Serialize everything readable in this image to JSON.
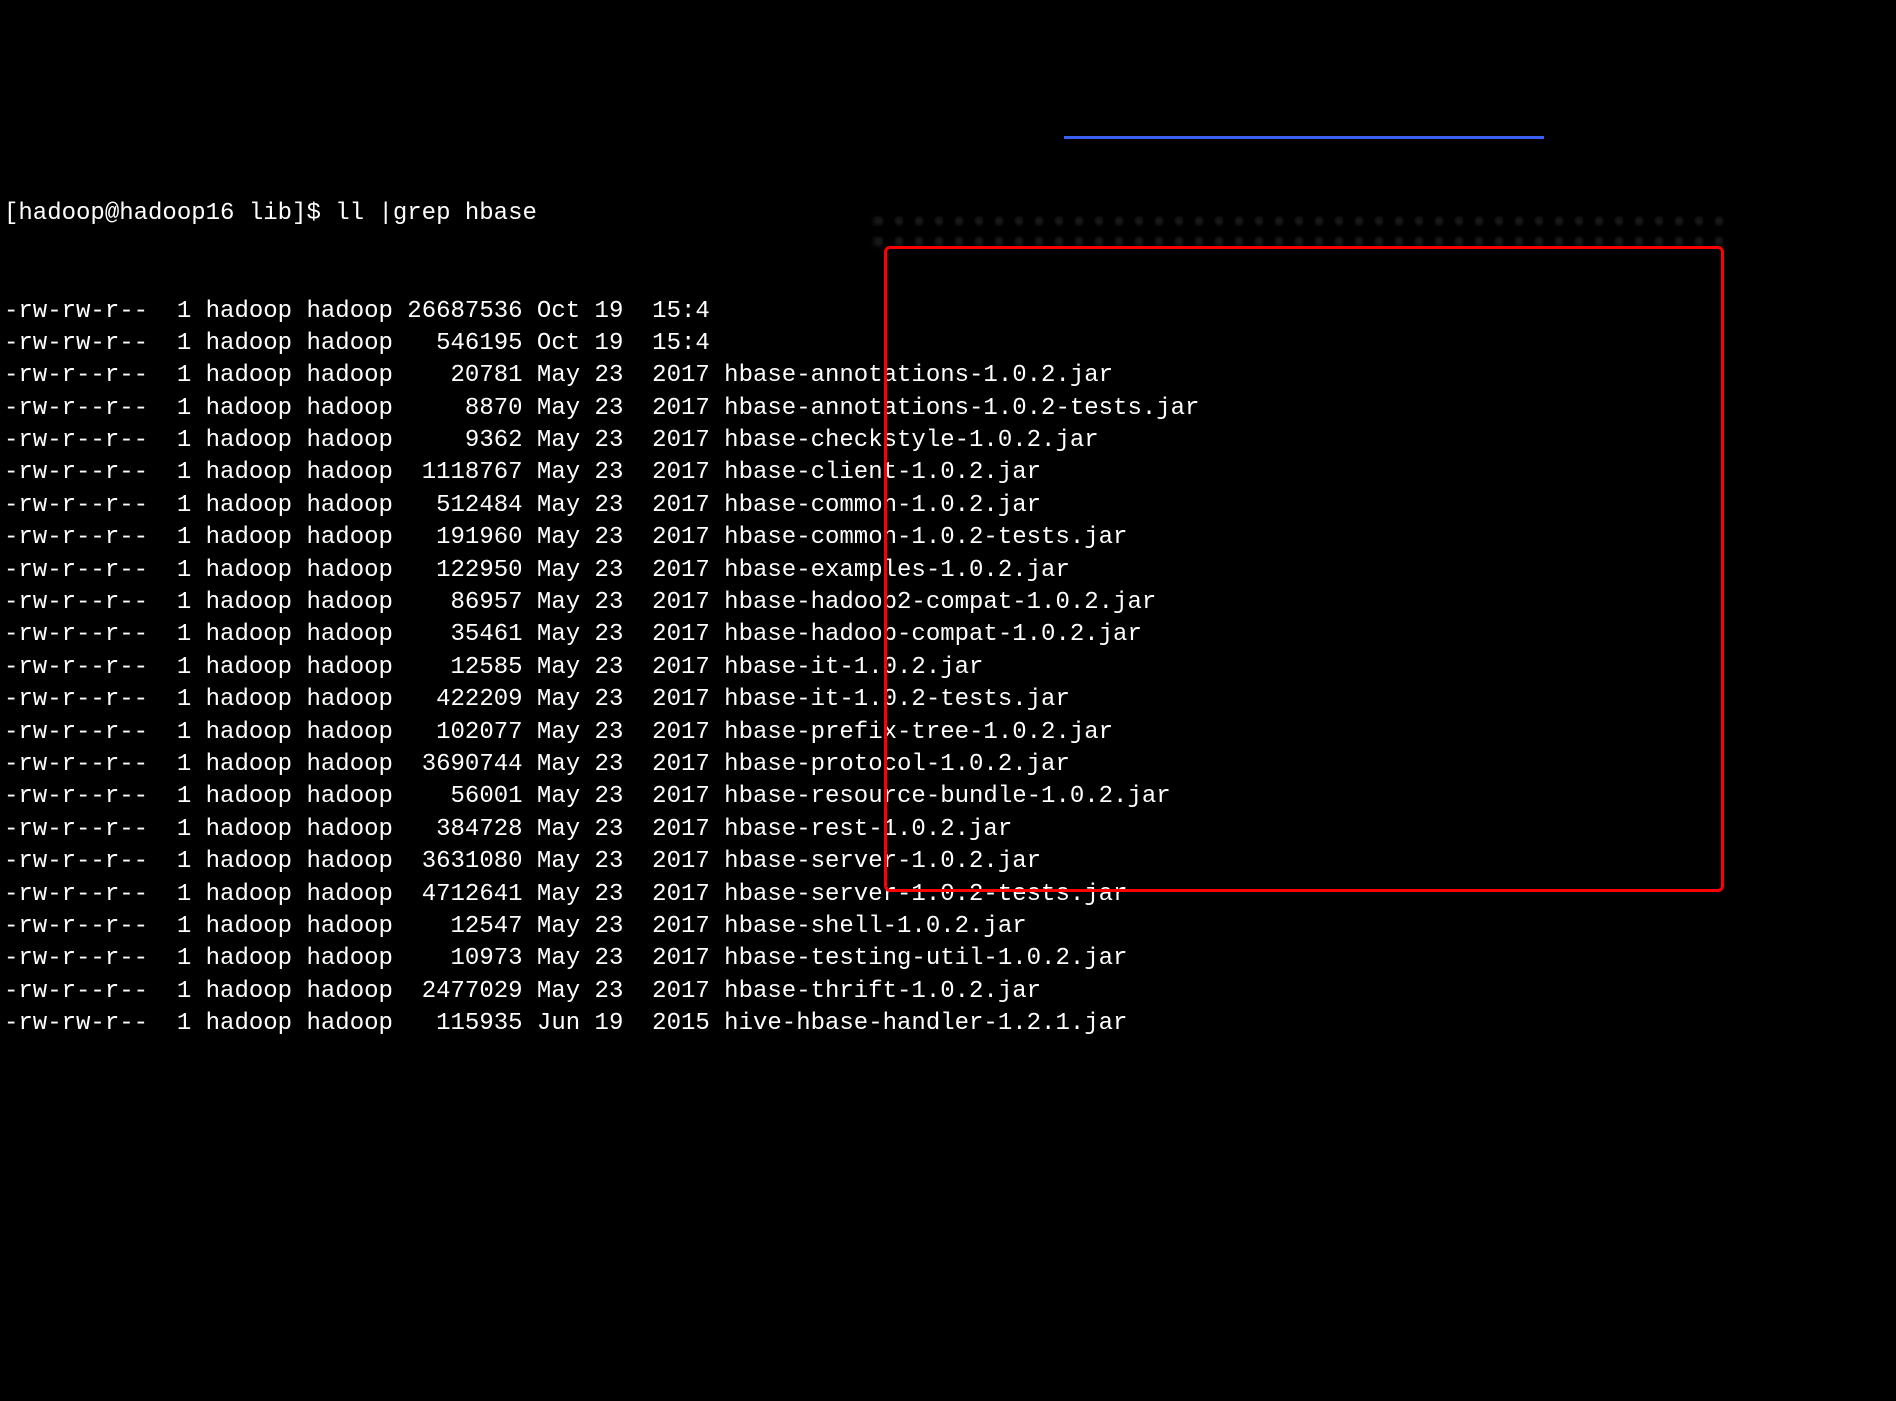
{
  "prompt": "[hadoop@hadoop16 lib]$ ll |grep hbase",
  "rows": [
    {
      "perm": "-rw-rw-r--",
      "links": "1",
      "owner": "hadoop",
      "group": "hadoop",
      "size": "26687536",
      "month": "Oct",
      "day": "19",
      "time": "15:4",
      "filename": "",
      "hl": false
    },
    {
      "perm": "-rw-rw-r--",
      "links": "1",
      "owner": "hadoop",
      "group": "hadoop",
      "size": "546195",
      "month": "Oct",
      "day": "19",
      "time": "15:4",
      "filename": "",
      "hl": false
    },
    {
      "perm": "-rw-r--r--",
      "links": "1",
      "owner": "hadoop",
      "group": "hadoop",
      "size": "20781",
      "month": "May",
      "day": "23",
      "time": "2017",
      "filename": "hbase-annotations-1.0.2.jar",
      "hl": true
    },
    {
      "perm": "-rw-r--r--",
      "links": "1",
      "owner": "hadoop",
      "group": "hadoop",
      "size": "8870",
      "month": "May",
      "day": "23",
      "time": "2017",
      "filename": "hbase-annotations-1.0.2-tests.jar",
      "hl": true
    },
    {
      "perm": "-rw-r--r--",
      "links": "1",
      "owner": "hadoop",
      "group": "hadoop",
      "size": "9362",
      "month": "May",
      "day": "23",
      "time": "2017",
      "filename": "hbase-checkstyle-1.0.2.jar",
      "hl": true
    },
    {
      "perm": "-rw-r--r--",
      "links": "1",
      "owner": "hadoop",
      "group": "hadoop",
      "size": "1118767",
      "month": "May",
      "day": "23",
      "time": "2017",
      "filename": "hbase-client-1.0.2.jar",
      "hl": true
    },
    {
      "perm": "-rw-r--r--",
      "links": "1",
      "owner": "hadoop",
      "group": "hadoop",
      "size": "512484",
      "month": "May",
      "day": "23",
      "time": "2017",
      "filename": "hbase-common-1.0.2.jar",
      "hl": true
    },
    {
      "perm": "-rw-r--r--",
      "links": "1",
      "owner": "hadoop",
      "group": "hadoop",
      "size": "191960",
      "month": "May",
      "day": "23",
      "time": "2017",
      "filename": "hbase-common-1.0.2-tests.jar",
      "hl": true
    },
    {
      "perm": "-rw-r--r--",
      "links": "1",
      "owner": "hadoop",
      "group": "hadoop",
      "size": "122950",
      "month": "May",
      "day": "23",
      "time": "2017",
      "filename": "hbase-examples-1.0.2.jar",
      "hl": true
    },
    {
      "perm": "-rw-r--r--",
      "links": "1",
      "owner": "hadoop",
      "group": "hadoop",
      "size": "86957",
      "month": "May",
      "day": "23",
      "time": "2017",
      "filename": "hbase-hadoop2-compat-1.0.2.jar",
      "hl": true
    },
    {
      "perm": "-rw-r--r--",
      "links": "1",
      "owner": "hadoop",
      "group": "hadoop",
      "size": "35461",
      "month": "May",
      "day": "23",
      "time": "2017",
      "filename": "hbase-hadoop-compat-1.0.2.jar",
      "hl": true
    },
    {
      "perm": "-rw-r--r--",
      "links": "1",
      "owner": "hadoop",
      "group": "hadoop",
      "size": "12585",
      "month": "May",
      "day": "23",
      "time": "2017",
      "filename": "hbase-it-1.0.2.jar",
      "hl": true
    },
    {
      "perm": "-rw-r--r--",
      "links": "1",
      "owner": "hadoop",
      "group": "hadoop",
      "size": "422209",
      "month": "May",
      "day": "23",
      "time": "2017",
      "filename": "hbase-it-1.0.2-tests.jar",
      "hl": true
    },
    {
      "perm": "-rw-r--r--",
      "links": "1",
      "owner": "hadoop",
      "group": "hadoop",
      "size": "102077",
      "month": "May",
      "day": "23",
      "time": "2017",
      "filename": "hbase-prefix-tree-1.0.2.jar",
      "hl": true
    },
    {
      "perm": "-rw-r--r--",
      "links": "1",
      "owner": "hadoop",
      "group": "hadoop",
      "size": "3690744",
      "month": "May",
      "day": "23",
      "time": "2017",
      "filename": "hbase-protocol-1.0.2.jar",
      "hl": true
    },
    {
      "perm": "-rw-r--r--",
      "links": "1",
      "owner": "hadoop",
      "group": "hadoop",
      "size": "56001",
      "month": "May",
      "day": "23",
      "time": "2017",
      "filename": "hbase-resource-bundle-1.0.2.jar",
      "hl": true
    },
    {
      "perm": "-rw-r--r--",
      "links": "1",
      "owner": "hadoop",
      "group": "hadoop",
      "size": "384728",
      "month": "May",
      "day": "23",
      "time": "2017",
      "filename": "hbase-rest-1.0.2.jar",
      "hl": true
    },
    {
      "perm": "-rw-r--r--",
      "links": "1",
      "owner": "hadoop",
      "group": "hadoop",
      "size": "3631080",
      "month": "May",
      "day": "23",
      "time": "2017",
      "filename": "hbase-server-1.0.2.jar",
      "hl": true
    },
    {
      "perm": "-rw-r--r--",
      "links": "1",
      "owner": "hadoop",
      "group": "hadoop",
      "size": "4712641",
      "month": "May",
      "day": "23",
      "time": "2017",
      "filename": "hbase-server-1.0.2-tests.jar",
      "hl": true
    },
    {
      "perm": "-rw-r--r--",
      "links": "1",
      "owner": "hadoop",
      "group": "hadoop",
      "size": "12547",
      "month": "May",
      "day": "23",
      "time": "2017",
      "filename": "hbase-shell-1.0.2.jar",
      "hl": true
    },
    {
      "perm": "-rw-r--r--",
      "links": "1",
      "owner": "hadoop",
      "group": "hadoop",
      "size": "10973",
      "month": "May",
      "day": "23",
      "time": "2017",
      "filename": "hbase-testing-util-1.0.2.jar",
      "hl": true
    },
    {
      "perm": "-rw-r--r--",
      "links": "1",
      "owner": "hadoop",
      "group": "hadoop",
      "size": "2477029",
      "month": "May",
      "day": "23",
      "time": "2017",
      "filename": "hbase-thrift-1.0.2.jar",
      "hl": true
    },
    {
      "perm": "-rw-rw-r--",
      "links": "1",
      "owner": "hadoop",
      "group": "hadoop",
      "size": "115935",
      "month": "Jun",
      "day": "19",
      "time": "2015",
      "filename": "hive-hbase-handler-1.2.1.jar",
      "hl": false
    }
  ]
}
